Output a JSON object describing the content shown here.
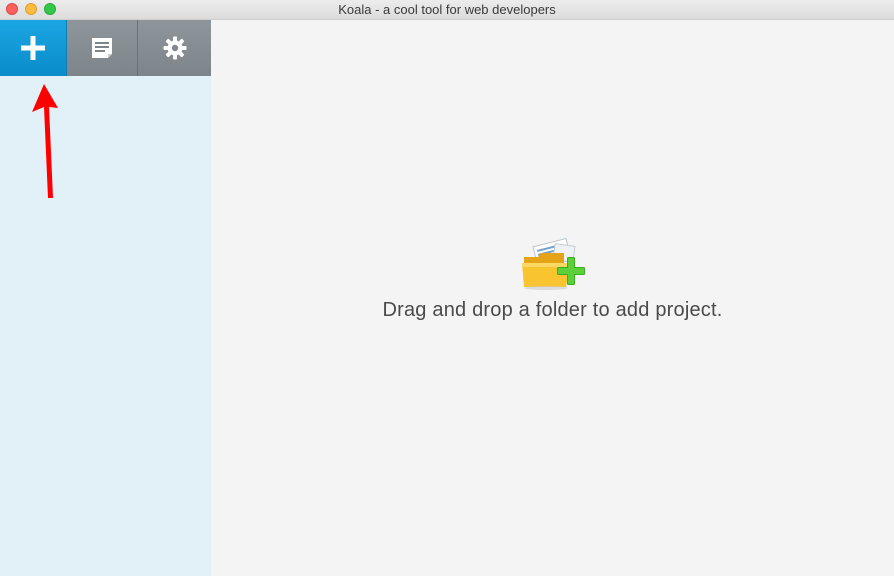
{
  "window": {
    "title": "Koala - a cool tool for web developers"
  },
  "titlebar": {
    "buttons": [
      "close",
      "minimize",
      "zoom"
    ],
    "colors": {
      "close": "#fc605c",
      "minimize": "#fdbc40",
      "zoom": "#34c84a"
    }
  },
  "sidebar": {
    "toolbar": [
      {
        "name": "add-project",
        "icon": "plus-icon"
      },
      {
        "name": "log",
        "icon": "document-icon"
      },
      {
        "name": "settings",
        "icon": "gear-icon"
      }
    ],
    "active_color": "#0a8cc9",
    "background": "#e2f0f8"
  },
  "annotation": {
    "type": "arrow",
    "color": "#ff0000"
  },
  "main": {
    "empty_state": {
      "icon": "folder-add-icon",
      "text": "Drag and drop a folder to add project."
    }
  }
}
